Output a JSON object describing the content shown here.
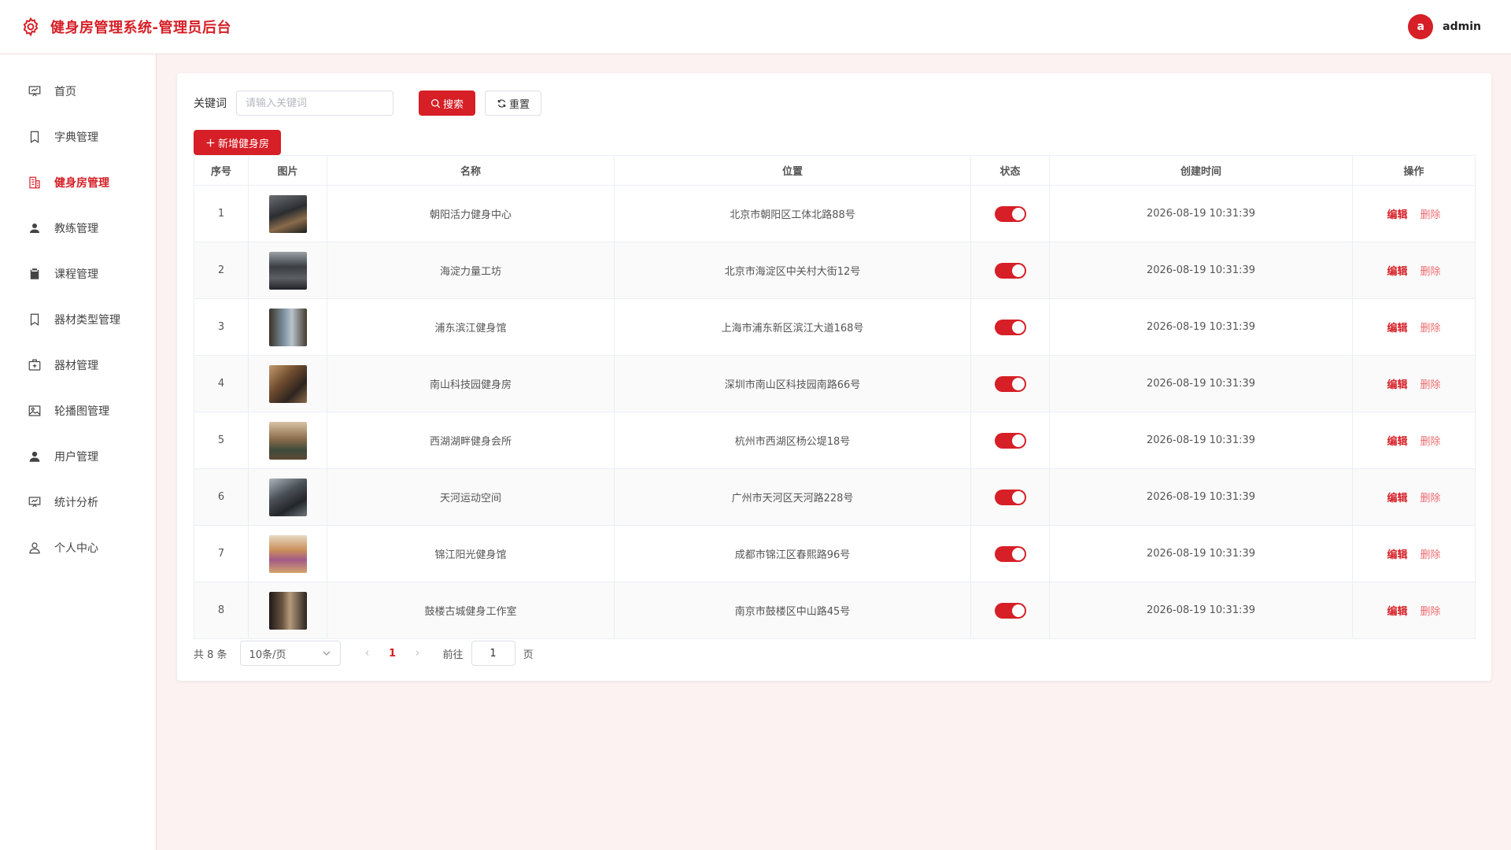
{
  "header": {
    "title": "健身房管理系统-管理员后台",
    "avatar_letter": "a",
    "username": "admin",
    "accent": "#d61f26"
  },
  "sidebar": {
    "items": [
      {
        "label": "首页",
        "icon": "presentation-icon"
      },
      {
        "label": "字典管理",
        "icon": "bookmark-icon"
      },
      {
        "label": "健身房管理",
        "icon": "building-icon",
        "active": true
      },
      {
        "label": "教练管理",
        "icon": "coach-icon"
      },
      {
        "label": "课程管理",
        "icon": "clipboard-icon"
      },
      {
        "label": "器材类型管理",
        "icon": "bookmark-icon"
      },
      {
        "label": "器材管理",
        "icon": "first-aid-box-icon"
      },
      {
        "label": "轮播图管理",
        "icon": "picture-icon"
      },
      {
        "label": "用户管理",
        "icon": "user-solid-icon"
      },
      {
        "label": "统计分析",
        "icon": "chart-board-icon"
      },
      {
        "label": "个人中心",
        "icon": "user-outline-icon"
      }
    ]
  },
  "toolbar": {
    "keyword_label": "关键词",
    "keyword_placeholder": "请输入关键词",
    "keyword_value": "",
    "search_label": "搜索",
    "reset_label": "重置",
    "add_label": "新增健身房"
  },
  "table": {
    "headers": [
      "序号",
      "图片",
      "名称",
      "位置",
      "状态",
      "创建时间",
      "操作"
    ],
    "edit_label": "编辑",
    "delete_label": "删除",
    "rows": [
      {
        "no": "1",
        "name": "朝阳活力健身中心",
        "location": "北京市朝阳区工体北路88号",
        "status": true,
        "created": "2026-08-19 10:31:39"
      },
      {
        "no": "2",
        "name": "海淀力量工坊",
        "location": "北京市海淀区中关村大街12号",
        "status": true,
        "created": "2026-08-19 10:31:39"
      },
      {
        "no": "3",
        "name": "浦东滨江健身馆",
        "location": "上海市浦东新区滨江大道168号",
        "status": true,
        "created": "2026-08-19 10:31:39"
      },
      {
        "no": "4",
        "name": "南山科技园健身房",
        "location": "深圳市南山区科技园南路66号",
        "status": true,
        "created": "2026-08-19 10:31:39"
      },
      {
        "no": "5",
        "name": "西湖湖畔健身会所",
        "location": "杭州市西湖区杨公堤18号",
        "status": true,
        "created": "2026-08-19 10:31:39"
      },
      {
        "no": "6",
        "name": "天河运动空间",
        "location": "广州市天河区天河路228号",
        "status": true,
        "created": "2026-08-19 10:31:39"
      },
      {
        "no": "7",
        "name": "锦江阳光健身馆",
        "location": "成都市锦江区春熙路96号",
        "status": true,
        "created": "2026-08-19 10:31:39"
      },
      {
        "no": "8",
        "name": "鼓楼古城健身工作室",
        "location": "南京市鼓楼区中山路45号",
        "status": true,
        "created": "2026-08-19 10:31:39"
      }
    ]
  },
  "pagination": {
    "total_text": "共 8 条",
    "page_size": "10条/页",
    "current_page": "1",
    "goto_label": "前往",
    "goto_value": "1",
    "page_suffix": "页"
  }
}
